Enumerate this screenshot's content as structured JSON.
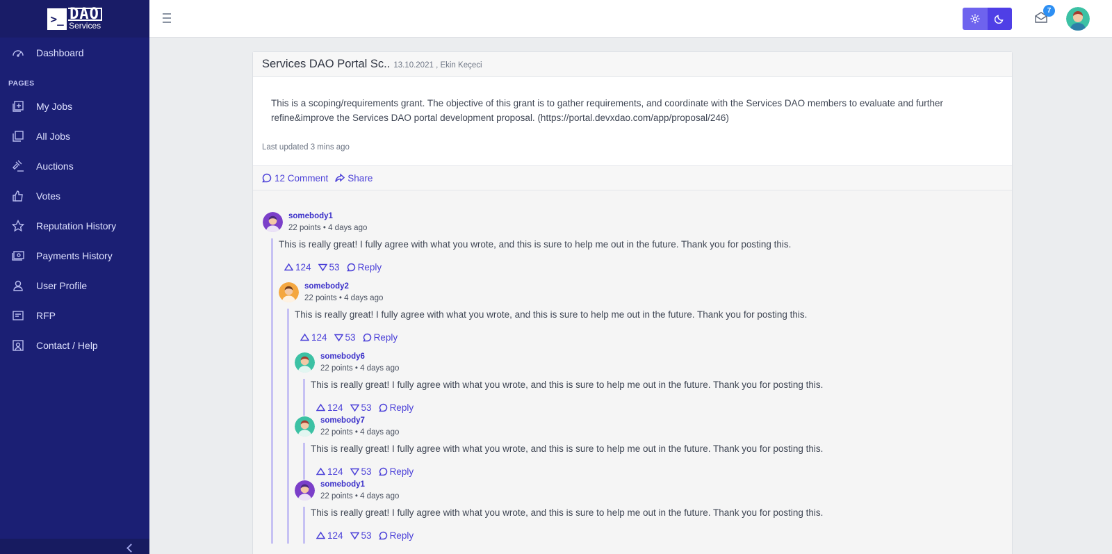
{
  "app": {
    "logo_mark": ">_",
    "logo_name": "DAO",
    "logo_sub": "Services"
  },
  "sidebar": {
    "top_items": [
      {
        "label": "Dashboard",
        "icon": "speedometer-icon"
      }
    ],
    "section_title": "PAGES",
    "items": [
      {
        "label": "My Jobs",
        "icon": "add-note-icon"
      },
      {
        "label": "All Jobs",
        "icon": "copy-icon"
      },
      {
        "label": "Auctions",
        "icon": "gavel-icon"
      },
      {
        "label": "Votes",
        "icon": "thumb-up-icon"
      },
      {
        "label": "Reputation History",
        "icon": "star-icon"
      },
      {
        "label": "Payments History",
        "icon": "money-icon"
      },
      {
        "label": "User Profile",
        "icon": "user-icon"
      },
      {
        "label": "RFP",
        "icon": "notes-icon"
      },
      {
        "label": "Contact / Help",
        "icon": "contact-icon"
      }
    ]
  },
  "header": {
    "mail_badge": "7"
  },
  "post": {
    "title": "Services DAO Portal Sc..",
    "meta": "13.10.2021 , Ekin Keçeci",
    "text_line1": "This is a scoping/requirements grant. The objective of this grant is to gather requirements, and coordinate with the Services DAO members to evaluate and further",
    "text_line2": "refine&improve the Services DAO portal development proposal. (https://portal.devxdao.com/app/proposal/246)",
    "updated": "Last updated 3 mins ago",
    "comment_label": "12 Comment",
    "share_label": "Share"
  },
  "colors": {
    "sidebar_bg": "#1b1f74",
    "accent": "#4a3fd8",
    "thread_line": "#c6c1f3",
    "badge": "#2d8ff3"
  },
  "comments": [
    {
      "user": "somebody1",
      "meta": "22 points • 4 days ago",
      "text": "This is really great! I fully agree with what you wrote, and this is sure to help me out in the future. Thank you for posting this.",
      "up": "124",
      "down": "53",
      "reply": "Reply",
      "avatar": "purple",
      "children": [
        {
          "user": "somebody2",
          "meta": "22 points • 4 days ago",
          "text": "This is really great! I fully agree with what you wrote, and this is sure to help me out in the future. Thank you for posting this.",
          "up": "124",
          "down": "53",
          "reply": "Reply",
          "avatar": "orange",
          "children": [
            {
              "user": "somebody6",
              "meta": "22 points • 4 days ago",
              "text": "This is really great! I fully agree with what you wrote, and this is sure to help me out in the future. Thank you for posting this.",
              "up": "124",
              "down": "53",
              "reply": "Reply",
              "avatar": "teal",
              "children": []
            },
            {
              "user": "somebody7",
              "meta": "22 points • 4 days ago",
              "text": "This is really great! I fully agree with what you wrote, and this is sure to help me out in the future. Thank you for posting this.",
              "up": "124",
              "down": "53",
              "reply": "Reply",
              "avatar": "teal",
              "children": []
            },
            {
              "user": "somebody1",
              "meta": "22 points • 4 days ago",
              "text": "This is really great! I fully agree with what you wrote, and this is sure to help me out in the future. Thank you for posting this.",
              "up": "124",
              "down": "53",
              "reply": "Reply",
              "avatar": "purple",
              "children": []
            }
          ]
        }
      ]
    }
  ]
}
